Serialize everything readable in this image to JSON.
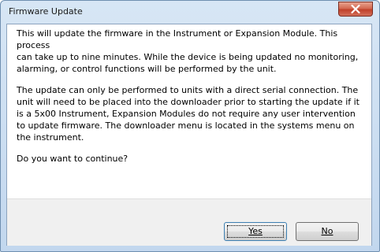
{
  "window": {
    "title": "Firmware Update",
    "close_icon": "close-icon"
  },
  "message": {
    "paragraph1": [
      "This will update the firmware in the Instrument or Expansion Module.  This",
      "process",
      "can take up to nine minutes.  While the device is being updated no monitoring,",
      "alarming, or control functions will be performed by the unit."
    ],
    "paragraph2": [
      "The update can only be performed to units with a direct serial connection.  The",
      "unit will need to be placed into the downloader prior to starting the update if it",
      "is a 5x00 Instrument, Expansion Modules do not require any user intervention",
      "to update firmware.  The downloader menu is located in the systems menu on",
      "the instrument."
    ],
    "question": "Do you want to continue?"
  },
  "buttons": {
    "yes_label": "Yes",
    "no_label": "No"
  },
  "colors": {
    "close_button": "#c0412a",
    "title_bar": "#c2d7ee",
    "default_button_border": "#3c7fb1"
  }
}
